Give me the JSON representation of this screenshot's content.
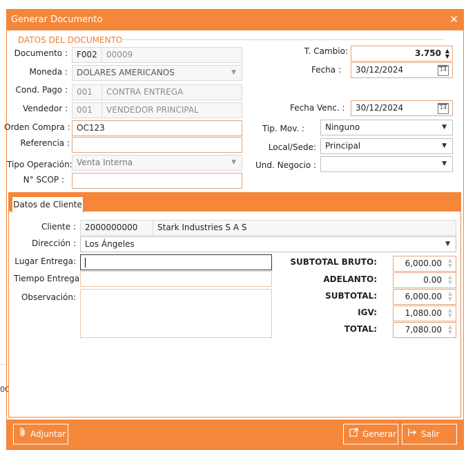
{
  "window": {
    "title": "Generar Documento",
    "close_icon": "close-icon"
  },
  "section": {
    "title": "DATOS DEL DOCUMENTO"
  },
  "documento": {
    "label": "Documento :",
    "serie": "F002",
    "numero": "00009"
  },
  "moneda": {
    "label": "Moneda :",
    "value": "DOLARES AMERICANOS"
  },
  "cond_pago": {
    "label": "Cond. Pago :",
    "code": "001",
    "value": "CONTRA ENTREGA"
  },
  "vendedor": {
    "label": "Vendedor :",
    "code": "001",
    "value": "VENDEDOR PRINCIPAL"
  },
  "orden_compra": {
    "label": "Orden Compra :",
    "value": "OC123"
  },
  "referencia": {
    "label": "Referencia :",
    "value": ""
  },
  "tipo_operacion": {
    "label": "Tipo Operación:",
    "value": "Venta Interna"
  },
  "scop": {
    "label": "N° SCOP :",
    "value": ""
  },
  "t_cambio": {
    "label": "T. Cambio:",
    "value": "3.750"
  },
  "fecha": {
    "label": "Fecha :",
    "value": "30/12/2024",
    "icon": "calendar-icon"
  },
  "fecha_venc": {
    "label": "Fecha Venc. :",
    "value": "30/12/2024",
    "icon": "calendar-icon"
  },
  "tip_mov": {
    "label": "Tip. Mov. :",
    "value": "Ninguno"
  },
  "local_sede": {
    "label": "Local/Sede:",
    "value": "Principal"
  },
  "und_negocio": {
    "label": "Und. Negocio :",
    "value": ""
  },
  "tabs": [
    {
      "label": "Datos de Cliente"
    }
  ],
  "cliente": {
    "label": "Cliente :",
    "code": "2000000000",
    "name": "Stark Industries S A S",
    "direccion_label": "Dirección :",
    "direccion": "Los Ángeles",
    "lugar_entrega_label": "Lugar Entrega:",
    "lugar_entrega": "",
    "tiempo_entrega_label": "Tiempo Entrega:",
    "tiempo_entrega": "",
    "observacion_label": "Observación:",
    "observacion": ""
  },
  "totals": {
    "subtotal_bruto_label": "SUBTOTAL BRUTO:",
    "subtotal_bruto": "6,000.00",
    "adelanto_label": "ADELANTO:",
    "adelanto": "0.00",
    "subtotal_label": "SUBTOTAL:",
    "subtotal": "6,000.00",
    "igv_label": "IGV:",
    "igv": "1,080.00",
    "total_label": "TOTAL:",
    "total": "7,080.00"
  },
  "footer": {
    "adjuntar": "Adjuntar",
    "adjuntar_icon": "paperclip-icon",
    "generar": "Generar",
    "generar_icon": "export-icon",
    "salir": "Salir",
    "salir_icon": "exit-icon"
  },
  "background": {
    "fragment": "00"
  },
  "colors": {
    "accent": "#f5873a",
    "field_border": "#e6a47a",
    "disabled_bg": "#f7f7f7"
  }
}
